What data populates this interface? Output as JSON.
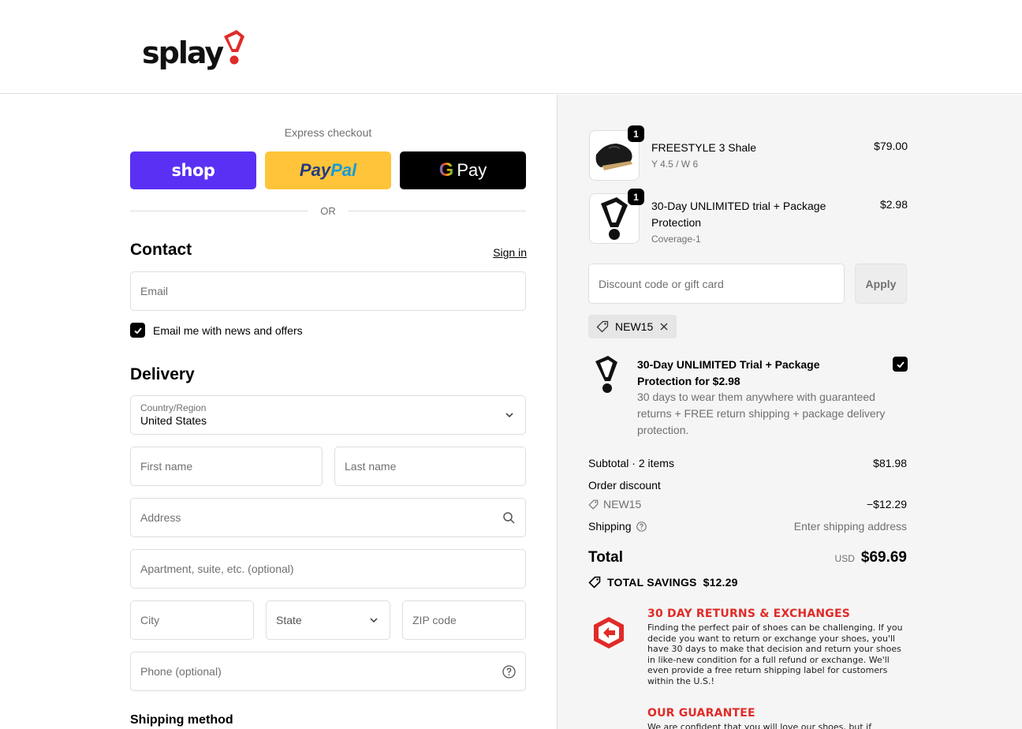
{
  "brand": {
    "logo_text": "splay"
  },
  "express": {
    "label": "Express checkout",
    "shop": "shop",
    "paypal_1": "Pay",
    "paypal_2": "Pal",
    "gpay_g": "G",
    "gpay": "Pay",
    "or": "OR"
  },
  "contact": {
    "title": "Contact",
    "sign_in": "Sign in",
    "email_placeholder": "Email",
    "news_label": "Email me with news and offers"
  },
  "delivery": {
    "title": "Delivery",
    "country_label": "Country/Region",
    "country_value": "United States",
    "first_name": "First name",
    "last_name": "Last name",
    "address": "Address",
    "apartment": "Apartment, suite, etc. (optional)",
    "city": "City",
    "state": "State",
    "zip": "ZIP code",
    "phone": "Phone (optional)"
  },
  "shipping_method": {
    "title": "Shipping method"
  },
  "cart": {
    "items": [
      {
        "qty": "1",
        "name": "FREESTYLE 3 Shale",
        "variant": "Y 4.5 / W 6",
        "price": "$79.00"
      },
      {
        "qty": "1",
        "name": "30-Day UNLIMITED trial + Package Protection",
        "variant": "Coverage-1",
        "price": "$2.98"
      }
    ],
    "discount_placeholder": "Discount code or gift card",
    "apply": "Apply",
    "applied_code": "NEW15"
  },
  "upsell": {
    "title": "30-Day UNLIMITED Trial + Package Protection for $2.98",
    "desc": "30 days to wear them anywhere with guaranteed returns + FREE return shipping + package delivery protection."
  },
  "summary": {
    "subtotal_label": "Subtotal · 2 items",
    "subtotal": "$81.98",
    "order_discount_label": "Order discount",
    "discount_code": "NEW15",
    "discount_value": "−$12.29",
    "shipping_label": "Shipping",
    "shipping_value": "Enter shipping address",
    "total_label": "Total",
    "currency": "USD",
    "total": "$69.69",
    "savings_label": "TOTAL SAVINGS",
    "savings": "$12.29"
  },
  "promos": [
    {
      "title": "30 DAY RETURNS & EXCHANGES",
      "text": "Finding the perfect pair of shoes can be challenging. If you decide you want to return or exchange your shoes, you'll have 30 days to make that decision and return your shoes in like-new condition for a full refund or exchange. We'll even provide a free return shipping label for customers within the U.S.!"
    },
    {
      "title": "OUR GUARANTEE",
      "text": "We are confident that you will love our shoes, but if"
    }
  ],
  "colors": {
    "shop": "#5a31f4",
    "paypal": "#ffc439",
    "brand_red": "#e02b27"
  }
}
